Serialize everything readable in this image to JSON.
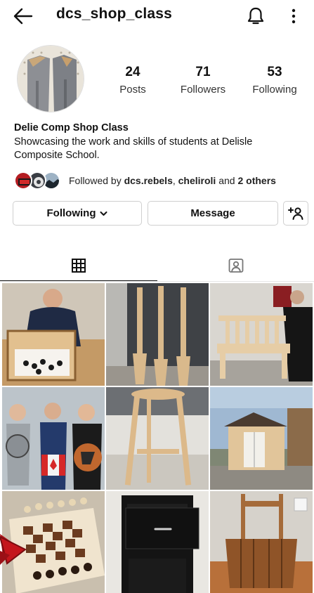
{
  "header": {
    "username": "dcs_shop_class",
    "back_icon": "arrow-left-icon",
    "bell_icon": "bell-icon",
    "more_icon": "more-vertical-icon"
  },
  "profile": {
    "stats": [
      {
        "value": "24",
        "label": "Posts"
      },
      {
        "value": "71",
        "label": "Followers"
      },
      {
        "value": "53",
        "label": "Following"
      }
    ],
    "name": "Delie Comp Shop Class",
    "bio": "Showcasing the work and skills of students at Delisle Composite School."
  },
  "followed_by": {
    "prefix": "Followed by ",
    "user1": "dcs.rebels",
    "sep": ", ",
    "user2": "cheliroli",
    "mid": " and ",
    "others": "2 others"
  },
  "actions": {
    "following_label": "Following",
    "message_label": "Message",
    "add_user_icon": "add-user-icon"
  },
  "tabs": [
    {
      "icon": "grid-icon",
      "active": true
    },
    {
      "icon": "tagged-icon",
      "active": false
    }
  ],
  "colors": {
    "text": "#111111",
    "border": "#cfcfcf",
    "annotation_arrow": "#c4161c"
  }
}
